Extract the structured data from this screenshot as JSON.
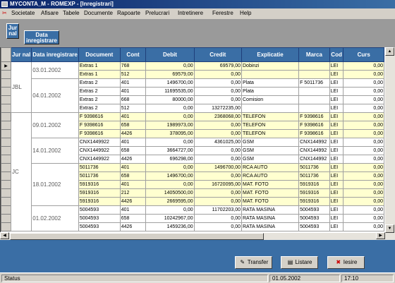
{
  "window": {
    "title": "MYCONTA_M - ROMEXP - [Inregistrari]"
  },
  "menu": [
    "Societate",
    "Afisare",
    "Tabele",
    "Documente",
    "Rapoarte",
    "Prelucrari",
    "Intretinere",
    "Ferestre",
    "Help"
  ],
  "group_buttons": {
    "jurnal": "Jur nal",
    "data": "Data inregistrare"
  },
  "columns": [
    "Jur nal",
    "Data inregistrare",
    "Document",
    "Cont",
    "Debit",
    "Credit",
    "Explicatie",
    "Marca",
    "Cod",
    "Curs"
  ],
  "groups": [
    {
      "jurnal": "JBL",
      "dates": [
        {
          "date": "03.01.2002",
          "rows": [
            {
              "doc": "Extras 1",
              "cont": "768",
              "debit": "0,00",
              "credit": "69579,00",
              "expl": "Dobinzi",
              "marca": "",
              "cod": "LEI",
              "curs": "0,00"
            },
            {
              "doc": "Extras 1",
              "cont": "512",
              "debit": "69579,00",
              "credit": "0,00",
              "expl": "",
              "marca": "",
              "cod": "LEI",
              "curs": "0,00"
            }
          ]
        },
        {
          "date": "04.01.2002",
          "rows": [
            {
              "doc": "Extras 2",
              "cont": "401",
              "debit": "1496700,00",
              "credit": "0,00",
              "expl": "Plata",
              "marca": "F 5011736",
              "cod": "LEI",
              "curs": "0,00"
            },
            {
              "doc": "Extras 2",
              "cont": "401",
              "debit": "11695535,00",
              "credit": "0,00",
              "expl": "Plata",
              "marca": "",
              "cod": "LEI",
              "curs": "0,00"
            },
            {
              "doc": "Extras 2",
              "cont": "668",
              "debit": "80000,00",
              "credit": "0,00",
              "expl": "Comision",
              "marca": "",
              "cod": "LEI",
              "curs": "0,00"
            },
            {
              "doc": "Extras 2",
              "cont": "512",
              "debit": "0,00",
              "credit": "13272235,00",
              "expl": "",
              "marca": "",
              "cod": "LEI",
              "curs": "0,00"
            }
          ]
        }
      ]
    },
    {
      "jurnal": "JC",
      "dates": [
        {
          "date": "09.01.2002",
          "rows": [
            {
              "doc": "F 9398616",
              "cont": "401",
              "debit": "0,00",
              "credit": "2368068,00",
              "expl": "TELEFON",
              "marca": "F 9398616",
              "cod": "LEI",
              "curs": "0,00"
            },
            {
              "doc": "F 9398616",
              "cont": "658",
              "debit": "1989973,00",
              "credit": "0,00",
              "expl": "TELEFON",
              "marca": "F 9398616",
              "cod": "LEI",
              "curs": "0,00"
            },
            {
              "doc": "F 9398616",
              "cont": "4426",
              "debit": "378095,00",
              "credit": "0,00",
              "expl": "TELEFON",
              "marca": "F 9398616",
              "cod": "LEI",
              "curs": "0,00"
            }
          ]
        },
        {
          "date": "14.01.2002",
          "rows": [
            {
              "doc": "CNX1449922",
              "cont": "401",
              "debit": "0,00",
              "credit": "4361025,00",
              "expl": "GSM",
              "marca": "CNX144992",
              "cod": "LEI",
              "curs": "0,00"
            },
            {
              "doc": "CNX1449922",
              "cont": "658",
              "debit": "3664727,00",
              "credit": "0,00",
              "expl": "GSM",
              "marca": "CNX144992",
              "cod": "LEI",
              "curs": "0,00"
            },
            {
              "doc": "CNX1449922",
              "cont": "4426",
              "debit": "696298,00",
              "credit": "0,00",
              "expl": "GSM",
              "marca": "CNX144992",
              "cod": "LEI",
              "curs": "0,00"
            }
          ]
        },
        {
          "date": "18.01.2002",
          "rows": [
            {
              "doc": "5011736",
              "cont": "401",
              "debit": "0,00",
              "credit": "1496700,00",
              "expl": "RCA AUTO",
              "marca": "5011736",
              "cod": "LEI",
              "curs": "0,00"
            },
            {
              "doc": "5011736",
              "cont": "658",
              "debit": "1496700,00",
              "credit": "0,00",
              "expl": "RCA AUTO",
              "marca": "5011736",
              "cod": "LEI",
              "curs": "0,00"
            },
            {
              "doc": "5919316",
              "cont": "401",
              "debit": "0,00",
              "credit": "16720095,00",
              "expl": "MAT. FOTO",
              "marca": "5919316",
              "cod": "LEI",
              "curs": "0,00"
            },
            {
              "doc": "5919316",
              "cont": "212",
              "debit": "14050500,00",
              "credit": "0,00",
              "expl": "MAT. FOTO",
              "marca": "5919316",
              "cod": "LEI",
              "curs": "0,00"
            },
            {
              "doc": "5919316",
              "cont": "4426",
              "debit": "2669595,00",
              "credit": "0,00",
              "expl": "MAT. FOTO",
              "marca": "5919316",
              "cod": "LEI",
              "curs": "0,00"
            }
          ]
        },
        {
          "date": "01.02.2002",
          "rows": [
            {
              "doc": "5004593",
              "cont": "401",
              "debit": "0,00",
              "credit": "11702203,00",
              "expl": "RATA MASINA",
              "marca": "5004593",
              "cod": "LEI",
              "curs": "0,00"
            },
            {
              "doc": "5004593",
              "cont": "658",
              "debit": "10242967,00",
              "credit": "0,00",
              "expl": "RATA MASINA",
              "marca": "5004593",
              "cod": "LEI",
              "curs": "0,00"
            },
            {
              "doc": "5004593",
              "cont": "4426",
              "debit": "1459236,00",
              "credit": "0,00",
              "expl": "RATA MASINA",
              "marca": "5004593",
              "cod": "LEI",
              "curs": "0,00"
            }
          ]
        }
      ]
    }
  ],
  "buttons": {
    "transfer": "Transfer",
    "listare": "Listare",
    "iesire": "Iesire"
  },
  "status": {
    "label": "Status",
    "date": "01.05.2002",
    "time": "17:10"
  }
}
